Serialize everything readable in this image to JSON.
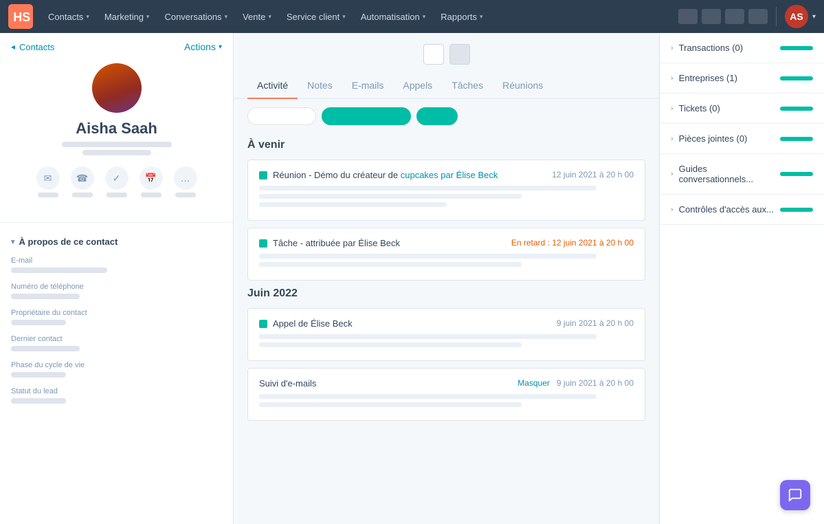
{
  "nav": {
    "items": [
      {
        "label": "Contacts",
        "id": "contacts"
      },
      {
        "label": "Marketing",
        "id": "marketing"
      },
      {
        "label": "Conversations",
        "id": "conversations"
      },
      {
        "label": "Vente",
        "id": "vente"
      },
      {
        "label": "Service client",
        "id": "service-client"
      },
      {
        "label": "Automatisation",
        "id": "automatisation"
      },
      {
        "label": "Rapports",
        "id": "rapports"
      }
    ]
  },
  "breadcrumb": {
    "back_label": "Contacts",
    "actions_label": "Actions"
  },
  "profile": {
    "name": "Aisha Saah"
  },
  "about": {
    "title": "À propos de ce contact",
    "fields": [
      {
        "label": "E-mail"
      },
      {
        "label": "Numéro de téléphone"
      },
      {
        "label": "Propriétaire du contact"
      },
      {
        "label": "Dernier contact"
      },
      {
        "label": "Phase du cycle de vie"
      },
      {
        "label": "Statut du lead"
      }
    ]
  },
  "tabs": [
    {
      "label": "Activité",
      "active": true
    },
    {
      "label": "Notes"
    },
    {
      "label": "E-mails"
    },
    {
      "label": "Appels"
    },
    {
      "label": "Tâches"
    },
    {
      "label": "Réunions"
    }
  ],
  "timeline": {
    "sections": [
      {
        "title": "À venir",
        "items": [
          {
            "type": "reunion",
            "dot_color": "green",
            "title_prefix": "Réunion - Démo du créateur de",
            "title_highlight": "cupcakes par Élise Beck",
            "date": "12 juin 2021 à 20 h 00",
            "date_overdue": false
          },
          {
            "type": "tache",
            "dot_color": "green",
            "title_prefix": "Tâche - attribuée par Élise Beck",
            "title_highlight": "",
            "date_label": "En retard : 12 juin 2021 à 20 h 00",
            "date_overdue": true
          }
        ]
      },
      {
        "title": "Juin 2022",
        "items": [
          {
            "type": "appel",
            "dot_color": "green",
            "title_prefix": "Appel",
            "title_highlight": "de Élise Beck",
            "date": "9 juin 2021 à 20 h 00",
            "date_overdue": false
          },
          {
            "type": "suivi",
            "dot_color": "none",
            "title_prefix": "Suivi d'e-mails",
            "title_highlight": "",
            "date_label_action": "Masquer",
            "date": "9 juin 2021 à 20 h 00",
            "date_overdue": false
          }
        ]
      }
    ]
  },
  "right_sidebar": {
    "items": [
      {
        "label": "Transactions (0)"
      },
      {
        "label": "Entreprises (1)"
      },
      {
        "label": "Tickets (0)"
      },
      {
        "label": "Pièces jointes (0)"
      },
      {
        "label": "Guides conversationnels..."
      },
      {
        "label": "Contrôles d'accès aux..."
      }
    ]
  }
}
